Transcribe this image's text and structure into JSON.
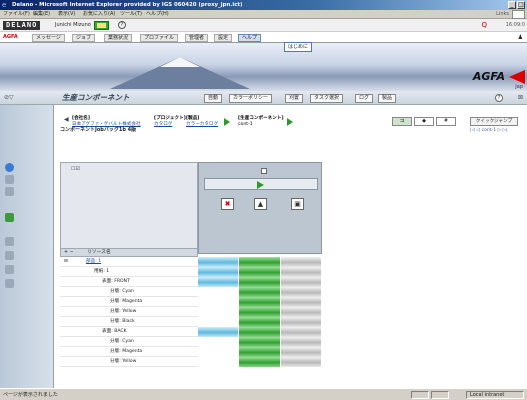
{
  "window": {
    "title": "Delano - Microsoft Internet Explorer provided by IGS 060420 (proxy_jpn.ict)"
  },
  "menu": {
    "items": [
      "ファイル(F)",
      "編集(E)",
      "表示(V)",
      "お気に入り(A)",
      "ツール(T)",
      "ヘルプ(H)"
    ],
    "links_label": "Links"
  },
  "app_header": {
    "logo": "DELANO",
    "user": "Junichi Mizuno",
    "time": "16:09:0"
  },
  "nav": {
    "brand": "AGFA",
    "tabs": [
      "メッセージ",
      "ジョブ",
      "業務状況",
      "プロファイル",
      "管理者",
      "設定",
      "ヘルプ"
    ],
    "active_tab": "ヘルプ",
    "dropdown_item": "はじめに"
  },
  "banner": {
    "brand": "AGFA",
    "region": "Jap"
  },
  "module": {
    "title": "生産コンポーネント",
    "buttons": [
      "自動",
      "カラーポリシー",
      "刈置",
      "タスク選択",
      "ログ",
      "製品"
    ]
  },
  "breadcrumb": {
    "items": [
      {
        "top": "[会社名]",
        "bottom": "日本アグファ・ゲバルト株式会社"
      },
      {
        "top": "[プロジェクト]",
        "bottom": "カタログ"
      },
      {
        "top": "[製品]",
        "bottom": "カラーカタログ"
      },
      {
        "top": "[生産コンポーネント]",
        "bottom": "cont-1"
      }
    ],
    "subtitle": "コンポーネントJobバッグ1b 4版",
    "quick_jump": "クイックジャンプ",
    "pager": "cont-1"
  },
  "grid": {
    "col_resource": "リソース名",
    "header_checkbox_label": "☐☑",
    "rows": [
      {
        "label": "部品: 1",
        "indent": 0,
        "link": true,
        "cells": [
          "blue",
          "green",
          "gray"
        ]
      },
      {
        "label": "用紙: 1",
        "indent": 1,
        "link": false,
        "cells": [
          "blue",
          "green",
          "gray"
        ]
      },
      {
        "label": "表面: FRONT",
        "indent": 2,
        "link": false,
        "cells": [
          "blue",
          "green",
          "gray"
        ]
      },
      {
        "label": "分版: Cyan",
        "indent": 3,
        "link": false,
        "cells": [
          "empty",
          "green",
          "gray"
        ]
      },
      {
        "label": "分版: Magenta",
        "indent": 3,
        "link": false,
        "cells": [
          "empty",
          "green",
          "gray"
        ]
      },
      {
        "label": "分版: Yellow",
        "indent": 3,
        "link": false,
        "cells": [
          "empty",
          "green",
          "gray"
        ]
      },
      {
        "label": "分版: Black",
        "indent": 3,
        "link": false,
        "cells": [
          "empty",
          "green",
          "gray"
        ]
      },
      {
        "label": "表面: BACK",
        "indent": 2,
        "link": false,
        "cells": [
          "blue",
          "green",
          "gray"
        ]
      },
      {
        "label": "分版: Cyan",
        "indent": 3,
        "link": false,
        "cells": [
          "empty",
          "green",
          "gray"
        ]
      },
      {
        "label": "分版: Magenta",
        "indent": 3,
        "link": false,
        "cells": [
          "empty",
          "green",
          "gray"
        ]
      },
      {
        "label": "分版: Yellow",
        "indent": 3,
        "link": false,
        "cells": [
          "empty",
          "green",
          "gray"
        ]
      }
    ]
  },
  "status": {
    "text": "ページが表示されました",
    "zone": "Local intranet"
  },
  "colors": {
    "accent": "#0a246a",
    "brand_red": "#dd0000",
    "status_green": "#2fa02f",
    "status_blue": "#5fb9dd",
    "status_gray": "#b8b8b8"
  },
  "icons": {
    "mail": "mail-icon",
    "help": "help-icon",
    "play": "play-icon",
    "back": "back-arrow-icon"
  }
}
